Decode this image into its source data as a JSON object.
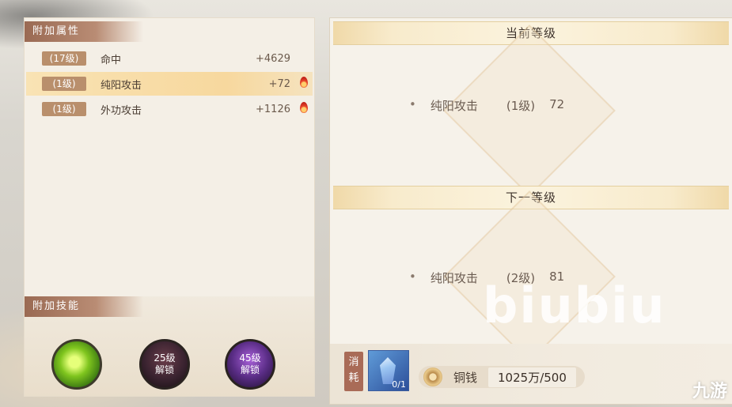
{
  "extra_attrs": {
    "tab_label": "附加属性",
    "rows": [
      {
        "level": "(17级)",
        "name": "命中",
        "value": "+4629"
      },
      {
        "level": "(1级)",
        "name": "纯阳攻击",
        "value": "+72"
      },
      {
        "level": "(1级)",
        "name": "外功攻击",
        "value": "+1126"
      }
    ]
  },
  "extra_skills": {
    "tab_label": "附加技能",
    "slots": [
      {
        "label": ""
      },
      {
        "label": "25级\n解锁"
      },
      {
        "label": "45级\n解锁"
      }
    ]
  },
  "current_level": {
    "title": "当前等级",
    "name": "纯阳攻击",
    "level": "(1级)",
    "value": "72"
  },
  "next_level": {
    "title": "下一等级",
    "name": "纯阳攻击",
    "level": "(2级)",
    "value": "81"
  },
  "cost": {
    "tag": "消\n耗",
    "item_count": "0/1",
    "currency_label": "铜钱",
    "currency_value": "1025万/500"
  },
  "watermark": "biubiu",
  "logo": "九游"
}
